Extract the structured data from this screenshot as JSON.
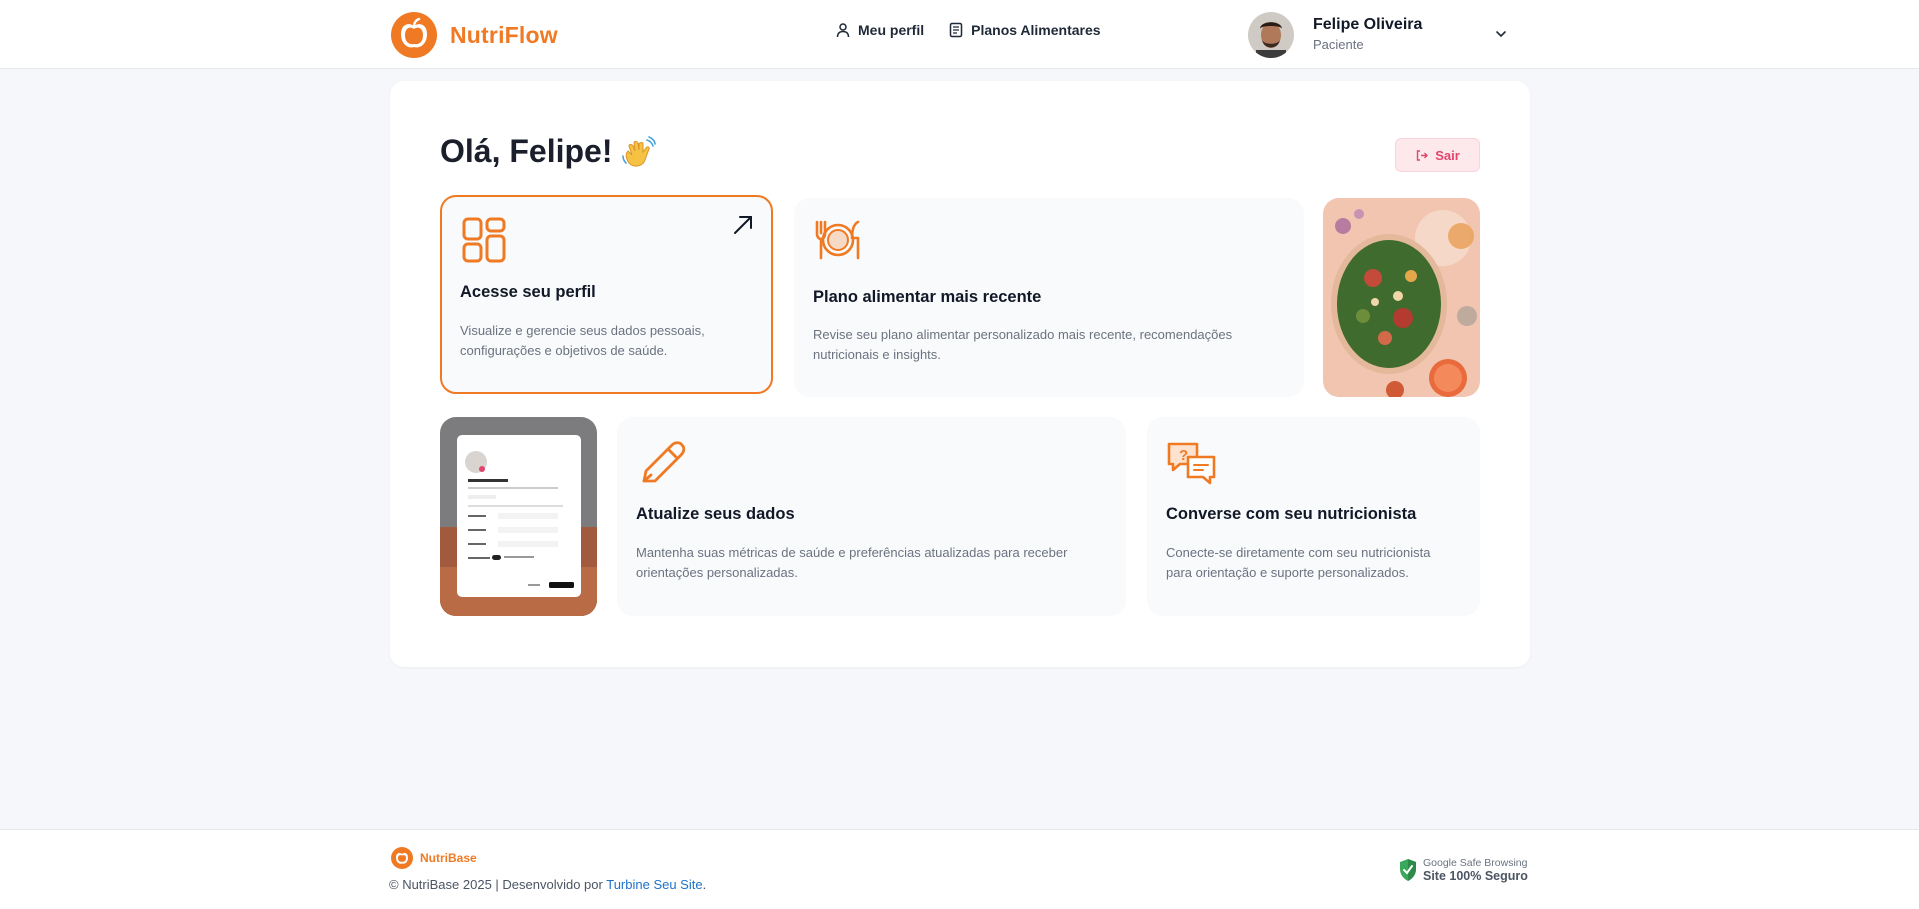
{
  "brand": {
    "name": "NutriFlow",
    "color": "#f07a23"
  },
  "nav": [
    {
      "label": "Meu perfil",
      "icon": "user-icon"
    },
    {
      "label": "Planos Alimentares",
      "icon": "document-icon"
    }
  ],
  "user": {
    "name": "Felipe Oliveira",
    "role": "Paciente"
  },
  "greeting": "Olá, Felipe!",
  "logout_label": "Sair",
  "cards": {
    "profile": {
      "title": "Acesse seu perfil",
      "desc": "Visualize e gerencie seus dados pessoais, configurações e objetivos de saúde."
    },
    "plan": {
      "title": "Plano alimentar mais recente",
      "desc": "Revise seu plano alimentar personalizado mais recente, recomendações nutricionais e insights."
    },
    "update": {
      "title": "Atualize seus dados",
      "desc": "Mantenha suas métricas de saúde e preferências atualizadas para receber orientações personalizadas."
    },
    "chat": {
      "title": "Converse com seu nutricionista",
      "desc": "Conecte-se diretamente com seu nutricionista para orientação e suporte personalizados."
    }
  },
  "footer": {
    "brand": "NutriBase",
    "copyright": "© NutriBase 2025 | Desenvolvido por ",
    "link": "Turbine Seu Site",
    "period": ".",
    "safe_line1": "Google Safe Browsing",
    "safe_line2": "Site 100% Seguro"
  },
  "colors": {
    "accent": "#f07a23",
    "danger": "#e2456b",
    "background": "#f6f7fa"
  }
}
